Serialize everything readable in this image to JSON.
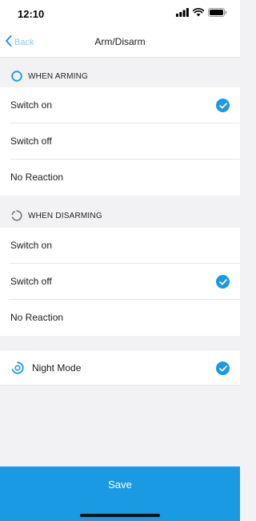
{
  "status_bar": {
    "time": "12:10",
    "icons": [
      "signal-icon",
      "wifi-icon",
      "battery-icon"
    ]
  },
  "nav": {
    "back_label": "Back",
    "title": "Arm/Disarm"
  },
  "sections": [
    {
      "label": "WHEN ARMING",
      "icon": "ring-icon",
      "options": [
        {
          "label": "Switch on",
          "selected": true
        },
        {
          "label": "Switch off",
          "selected": false
        },
        {
          "label": "No Reaction",
          "selected": false
        }
      ]
    },
    {
      "label": "WHEN DISARMING",
      "icon": "dashed-ring-icon",
      "options": [
        {
          "label": "Switch on",
          "selected": false
        },
        {
          "label": "Switch off",
          "selected": true
        },
        {
          "label": "No Reaction",
          "selected": false
        }
      ]
    }
  ],
  "night_mode": {
    "label": "Night Mode",
    "icon": "night-mode-icon",
    "selected": true
  },
  "save_label": "Save",
  "colors": {
    "accent": "#1a9ae3",
    "back_link": "#8cc9f0",
    "background": "#f2f2f4"
  }
}
